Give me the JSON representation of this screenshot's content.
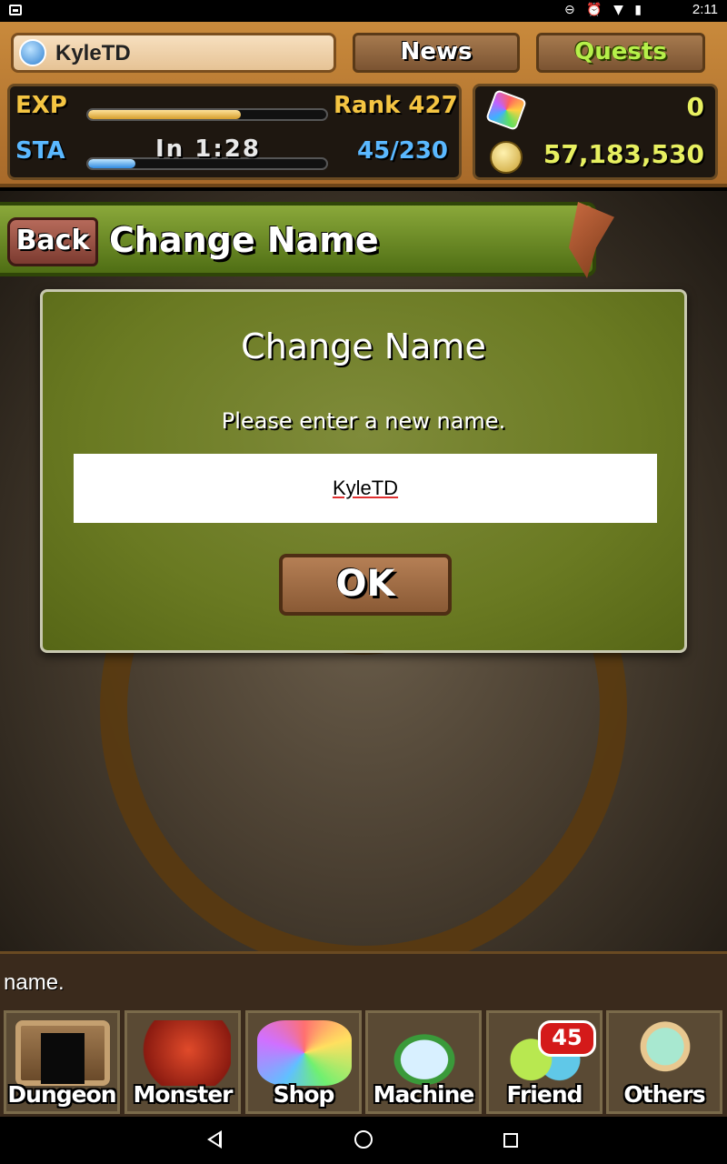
{
  "status_bar": {
    "time": "2:11",
    "icons": "⊖ ⏰ ▼ ▮"
  },
  "header": {
    "player_name": "KyleTD",
    "news_label": "News",
    "quests_label": "Quests",
    "exp_label": "EXP",
    "rank_text": "Rank 427",
    "exp_progress": 0.64,
    "sta_label": "STA",
    "stamina_timer": "In 1:28",
    "stamina_value": "45/230",
    "stamina_progress": 0.2,
    "magic_stones": "0",
    "coins": "57,183,530"
  },
  "title_bar": {
    "back_label": "Back",
    "title": "Change Name"
  },
  "dialog": {
    "title": "Change Name",
    "message": "Please enter a new name.",
    "input_value": "KyleTD",
    "ok_label": "OK"
  },
  "bottom": {
    "hint": "name.",
    "menu": [
      {
        "label": "Dungeon"
      },
      {
        "label": "Monster"
      },
      {
        "label": "Shop"
      },
      {
        "label": "Machine"
      },
      {
        "label": "Friend",
        "badge": "45"
      },
      {
        "label": "Others"
      }
    ]
  },
  "colors": {
    "dialog_green": "#6a7a22",
    "title_bar_green": "#6b8c26",
    "quests_text": "#b6f04a",
    "exp_text": "#f5c542",
    "sta_text": "#5ab8ff",
    "friend_badge": "#d41a1a"
  }
}
